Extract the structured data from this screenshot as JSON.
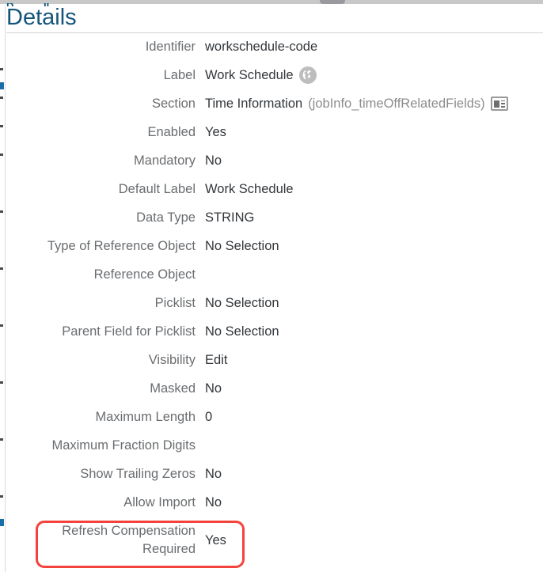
{
  "page": {
    "title": "Details"
  },
  "icons": {
    "globe": "globe-icon",
    "detail_view": "detail-view-icon"
  },
  "colors": {
    "title": "#14557c",
    "label": "#6a6d70",
    "value": "#32363a",
    "suffix": "#8b8d8e",
    "highlight": "#f4433c",
    "rule": "#d4d4d4"
  },
  "details": {
    "rows": [
      {
        "label": "Identifier",
        "value": "workschedule-code",
        "suffix": "",
        "icon": "",
        "wrapped": false,
        "highlighted": false
      },
      {
        "label": "Label",
        "value": "Work Schedule",
        "suffix": "",
        "icon": "globe",
        "wrapped": false,
        "highlighted": false
      },
      {
        "label": "Section",
        "value": "Time Information",
        "suffix": "(jobInfo_timeOffRelatedFields)",
        "icon": "detail-view",
        "wrapped": false,
        "highlighted": false
      },
      {
        "label": "Enabled",
        "value": "Yes",
        "suffix": "",
        "icon": "",
        "wrapped": false,
        "highlighted": false
      },
      {
        "label": "Mandatory",
        "value": "No",
        "suffix": "",
        "icon": "",
        "wrapped": false,
        "highlighted": false
      },
      {
        "label": "Default Label",
        "value": "Work Schedule",
        "suffix": "",
        "icon": "",
        "wrapped": false,
        "highlighted": false
      },
      {
        "label": "Data Type",
        "value": "STRING",
        "suffix": "",
        "icon": "",
        "wrapped": false,
        "highlighted": false
      },
      {
        "label": "Type of Reference Object",
        "value": "No Selection",
        "suffix": "",
        "icon": "",
        "wrapped": false,
        "highlighted": false
      },
      {
        "label": "Reference Object",
        "value": "",
        "suffix": "",
        "icon": "",
        "wrapped": false,
        "highlighted": false
      },
      {
        "label": "Picklist",
        "value": "No Selection",
        "suffix": "",
        "icon": "",
        "wrapped": false,
        "highlighted": false
      },
      {
        "label": "Parent Field for Picklist",
        "value": "No Selection",
        "suffix": "",
        "icon": "",
        "wrapped": false,
        "highlighted": false
      },
      {
        "label": "Visibility",
        "value": "Edit",
        "suffix": "",
        "icon": "",
        "wrapped": false,
        "highlighted": false
      },
      {
        "label": "Masked",
        "value": "No",
        "suffix": "",
        "icon": "",
        "wrapped": false,
        "highlighted": false
      },
      {
        "label": "Maximum Length",
        "value": "0",
        "suffix": "",
        "icon": "",
        "wrapped": false,
        "highlighted": false
      },
      {
        "label": "Maximum Fraction Digits",
        "value": "",
        "suffix": "",
        "icon": "",
        "wrapped": false,
        "highlighted": false
      },
      {
        "label": "Show Trailing Zeros",
        "value": "No",
        "suffix": "",
        "icon": "",
        "wrapped": false,
        "highlighted": false
      },
      {
        "label": "Allow Import",
        "value": "No",
        "suffix": "",
        "icon": "",
        "wrapped": false,
        "highlighted": false
      },
      {
        "label": "Refresh Compensation Required",
        "value": "Yes",
        "suffix": "",
        "icon": "",
        "wrapped": true,
        "highlighted": true
      }
    ]
  }
}
